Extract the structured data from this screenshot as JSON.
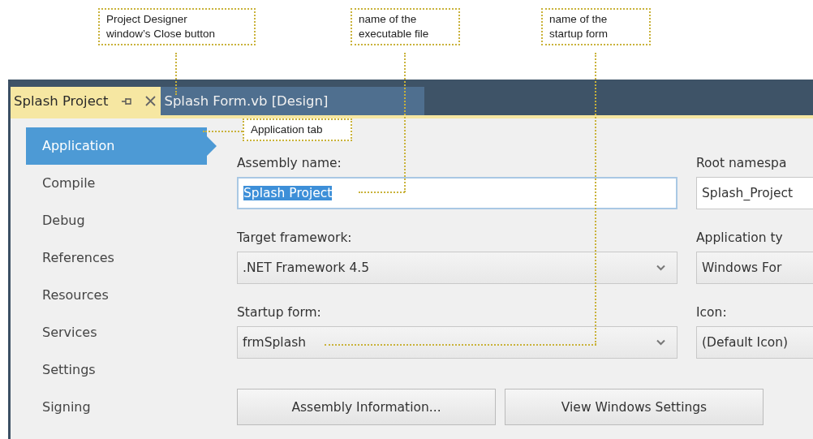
{
  "callouts": [
    {
      "lines": [
        "Project Designer",
        "window’s Close button"
      ]
    },
    {
      "lines": [
        "name of the",
        "executable file"
      ]
    },
    {
      "lines": [
        "name of the",
        "startup form"
      ]
    },
    {
      "lines": [
        "Application tab"
      ]
    }
  ],
  "tabs": [
    {
      "label": "Splash Project",
      "selected": true
    },
    {
      "label": "Splash Form.vb [Design]",
      "selected": false
    }
  ],
  "sidebar": {
    "items": [
      {
        "label": "Application",
        "selected": true
      },
      {
        "label": "Compile",
        "selected": false
      },
      {
        "label": "Debug",
        "selected": false
      },
      {
        "label": "References",
        "selected": false
      },
      {
        "label": "Resources",
        "selected": false
      },
      {
        "label": "Services",
        "selected": false
      },
      {
        "label": "Settings",
        "selected": false
      },
      {
        "label": "Signing",
        "selected": false
      }
    ]
  },
  "form": {
    "columns": [
      {
        "fields": [
          {
            "label": "Assembly name:",
            "kind": "text",
            "value": "Splash Project",
            "text_selected": true
          },
          {
            "label": "Target framework:",
            "kind": "dropdown",
            "value": ".NET Framework 4.5"
          },
          {
            "label": "Startup form:",
            "kind": "dropdown",
            "value": "frmSplash"
          }
        ]
      },
      {
        "fields": [
          {
            "label": "Root namespa",
            "kind": "text",
            "value": "Splash_Project",
            "text_selected": false
          },
          {
            "label": "Application ty",
            "kind": "dropdown",
            "value": "Windows For"
          },
          {
            "label": "Icon:",
            "kind": "dropdown",
            "value": "(Default Icon)"
          }
        ]
      }
    ],
    "buttons": [
      "Assembly Information...",
      "View Windows Settings"
    ]
  }
}
